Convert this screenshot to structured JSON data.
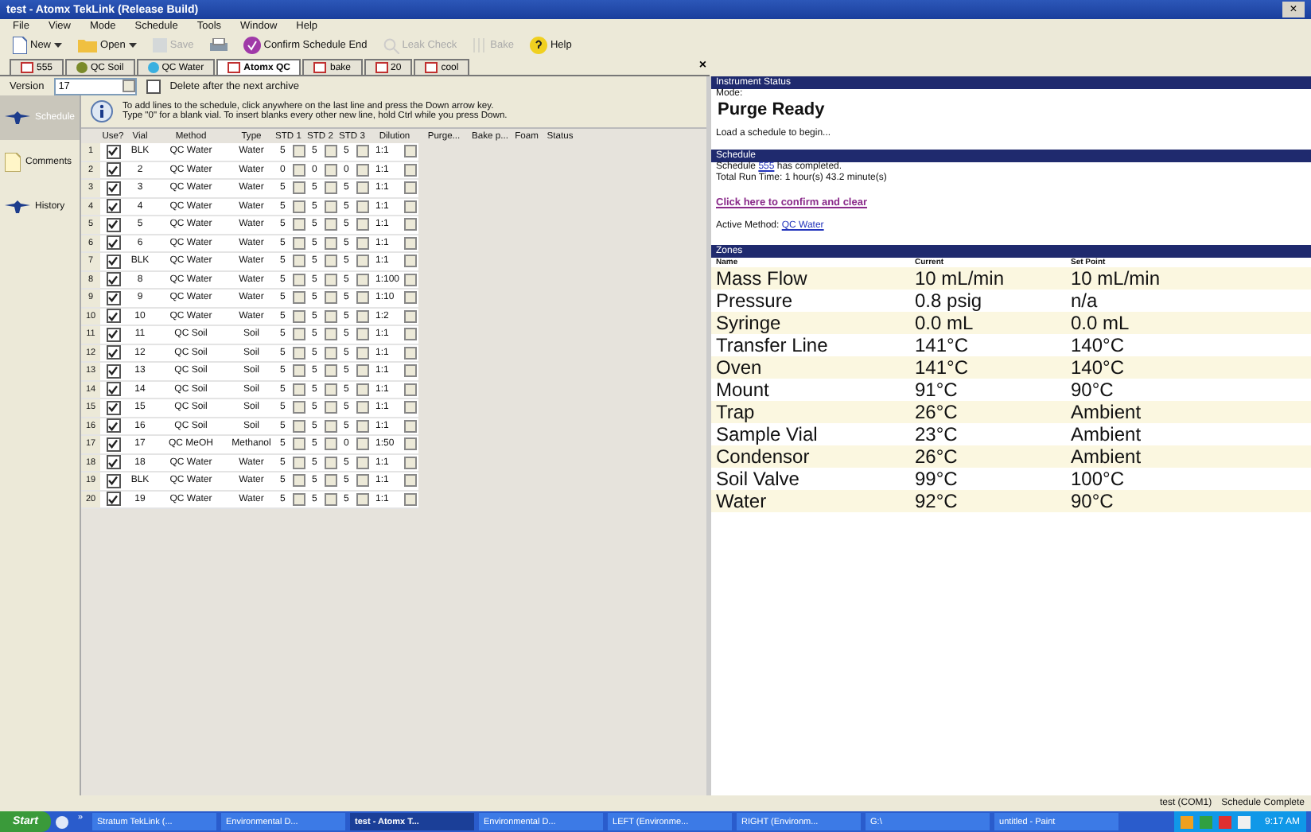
{
  "window": {
    "title": "test - Atomx TekLink (Release Build)",
    "close": "×"
  },
  "menu": [
    "File",
    "View",
    "Mode",
    "Schedule",
    "Tools",
    "Window",
    "Help"
  ],
  "toolbar": [
    {
      "kind": "new",
      "label": "New",
      "dropdown": true,
      "disabled": false
    },
    {
      "kind": "open",
      "label": "Open",
      "dropdown": true,
      "disabled": false
    },
    {
      "kind": "save",
      "label": "Save",
      "dropdown": false,
      "disabled": true
    },
    {
      "kind": "print",
      "dropdown": false,
      "disabled": false
    },
    {
      "kind": "confirm",
      "label": "Confirm Schedule End",
      "dropdown": false,
      "disabled": false
    },
    {
      "kind": "leak",
      "label": "Leak Check",
      "dropdown": false,
      "disabled": true
    },
    {
      "kind": "bake",
      "label": "Bake",
      "dropdown": false,
      "disabled": true
    },
    {
      "kind": "help",
      "label": "Help",
      "dropdown": false,
      "disabled": false
    }
  ],
  "tabs": [
    {
      "label": "555",
      "kind": "doc",
      "selected": false
    },
    {
      "label": "QC Soil",
      "kind": "soil",
      "selected": false
    },
    {
      "label": "QC Water",
      "kind": "water",
      "selected": false
    },
    {
      "label": "Atomx QC",
      "kind": "doc",
      "selected": true
    },
    {
      "label": "bake",
      "kind": "doc",
      "selected": false
    },
    {
      "label": "20",
      "kind": "doc",
      "selected": false
    },
    {
      "label": "cool",
      "kind": "doc",
      "selected": false
    }
  ],
  "tab_close": "×",
  "version": {
    "label": "Version",
    "value": "17",
    "delete_label": "Delete after the next archive",
    "delete_checked": false
  },
  "sidebar": [
    {
      "label": "Schedule",
      "kind": "bird",
      "selected": true
    },
    {
      "label": "Comments",
      "kind": "doc",
      "selected": false
    },
    {
      "label": "History",
      "kind": "bird",
      "selected": false
    }
  ],
  "info": [
    "To add lines to the schedule, click anywhere on the last line and press the Down arrow key.",
    "Type \"0\" for a blank vial. To insert blanks every other new line, hold Ctrl while you press Down."
  ],
  "table": {
    "columns": [
      "Use?",
      "Vial",
      "Method",
      "Type",
      "STD 1",
      "STD 2",
      "STD 3",
      "Dilution",
      "Purge...",
      "Bake p...",
      "Foam",
      "Status"
    ],
    "rows": [
      {
        "n": "1",
        "use": true,
        "vial": "BLK",
        "method": "QC Water",
        "type": "Water",
        "std": [
          "5",
          "5",
          "5"
        ],
        "dilution": "1:1"
      },
      {
        "n": "2",
        "use": true,
        "vial": "2",
        "method": "QC Water",
        "type": "Water",
        "std": [
          "0",
          "0",
          "0"
        ],
        "dilution": "1:1"
      },
      {
        "n": "3",
        "use": true,
        "vial": "3",
        "method": "QC Water",
        "type": "Water",
        "std": [
          "5",
          "5",
          "5"
        ],
        "dilution": "1:1"
      },
      {
        "n": "4",
        "use": true,
        "vial": "4",
        "method": "QC Water",
        "type": "Water",
        "std": [
          "5",
          "5",
          "5"
        ],
        "dilution": "1:1"
      },
      {
        "n": "5",
        "use": true,
        "vial": "5",
        "method": "QC Water",
        "type": "Water",
        "std": [
          "5",
          "5",
          "5"
        ],
        "dilution": "1:1"
      },
      {
        "n": "6",
        "use": true,
        "vial": "6",
        "method": "QC Water",
        "type": "Water",
        "std": [
          "5",
          "5",
          "5"
        ],
        "dilution": "1:1"
      },
      {
        "n": "7",
        "use": true,
        "vial": "BLK",
        "method": "QC Water",
        "type": "Water",
        "std": [
          "5",
          "5",
          "5"
        ],
        "dilution": "1:1"
      },
      {
        "n": "8",
        "use": true,
        "vial": "8",
        "method": "QC Water",
        "type": "Water",
        "std": [
          "5",
          "5",
          "5"
        ],
        "dilution": "1:100"
      },
      {
        "n": "9",
        "use": true,
        "vial": "9",
        "method": "QC Water",
        "type": "Water",
        "std": [
          "5",
          "5",
          "5"
        ],
        "dilution": "1:10"
      },
      {
        "n": "10",
        "use": true,
        "vial": "10",
        "method": "QC Water",
        "type": "Water",
        "std": [
          "5",
          "5",
          "5"
        ],
        "dilution": "1:2"
      },
      {
        "n": "11",
        "use": true,
        "vial": "11",
        "method": "QC Soil",
        "type": "Soil",
        "std": [
          "5",
          "5",
          "5"
        ],
        "dilution": "1:1"
      },
      {
        "n": "12",
        "use": true,
        "vial": "12",
        "method": "QC Soil",
        "type": "Soil",
        "std": [
          "5",
          "5",
          "5"
        ],
        "dilution": "1:1"
      },
      {
        "n": "13",
        "use": true,
        "vial": "13",
        "method": "QC Soil",
        "type": "Soil",
        "std": [
          "5",
          "5",
          "5"
        ],
        "dilution": "1:1"
      },
      {
        "n": "14",
        "use": true,
        "vial": "14",
        "method": "QC Soil",
        "type": "Soil",
        "std": [
          "5",
          "5",
          "5"
        ],
        "dilution": "1:1"
      },
      {
        "n": "15",
        "use": true,
        "vial": "15",
        "method": "QC Soil",
        "type": "Soil",
        "std": [
          "5",
          "5",
          "5"
        ],
        "dilution": "1:1"
      },
      {
        "n": "16",
        "use": true,
        "vial": "16",
        "method": "QC Soil",
        "type": "Soil",
        "std": [
          "5",
          "5",
          "5"
        ],
        "dilution": "1:1"
      },
      {
        "n": "17",
        "use": true,
        "vial": "17",
        "method": "QC MeOH",
        "type": "Methanol",
        "std": [
          "5",
          "5",
          "0"
        ],
        "dilution": "1:50"
      },
      {
        "n": "18",
        "use": true,
        "vial": "18",
        "method": "QC Water",
        "type": "Water",
        "std": [
          "5",
          "5",
          "5"
        ],
        "dilution": "1:1"
      },
      {
        "n": "19",
        "use": true,
        "vial": "BLK",
        "method": "QC Water",
        "type": "Water",
        "std": [
          "5",
          "5",
          "5"
        ],
        "dilution": "1:1"
      },
      {
        "n": "20",
        "use": true,
        "vial": "19",
        "method": "QC Water",
        "type": "Water",
        "std": [
          "5",
          "5",
          "5"
        ],
        "dilution": "1:1"
      }
    ]
  },
  "status_panel": {
    "title": "Instrument Status",
    "mode_label": "Mode:",
    "mode": "Purge Ready",
    "hint": "Load a schedule to begin...",
    "schedule_title": "Schedule",
    "schedule_pre": "Schedule ",
    "schedule_link": "555",
    "schedule_post": " has completed.",
    "run_time": "Total Run Time: 1 hour(s) 43.2 minute(s)",
    "confirm_link": "Click here to confirm and clear",
    "active_label": "Active Method: ",
    "active_link": "QC Water",
    "zones_title": "Zones",
    "zone_columns": [
      "Name",
      "Current",
      "Set Point"
    ],
    "zones": [
      [
        "Mass Flow",
        "10 mL/min",
        "10 mL/min"
      ],
      [
        "Pressure",
        "0.8 psig",
        "n/a"
      ],
      [
        "Syringe",
        "0.0 mL",
        "0.0 mL"
      ],
      [
        "Transfer Line",
        "141°C",
        "140°C"
      ],
      [
        "Oven",
        "141°C",
        "140°C"
      ],
      [
        "Mount",
        "91°C",
        "90°C"
      ],
      [
        "Trap",
        "26°C",
        "Ambient"
      ],
      [
        "Sample Vial",
        "23°C",
        "Ambient"
      ],
      [
        "Condensor",
        "26°C",
        "Ambient"
      ],
      [
        "Soil Valve",
        "99°C",
        "100°C"
      ],
      [
        "Water",
        "92°C",
        "90°C"
      ]
    ]
  },
  "status_bar": {
    "port": "test (COM1)",
    "state": "Schedule Complete"
  },
  "taskbar": {
    "start": "Start",
    "more": "»",
    "items": [
      {
        "label": "Stratum TekLink (...",
        "selected": false
      },
      {
        "label": "Environmental D...",
        "selected": false
      },
      {
        "label": "test - Atomx T...",
        "selected": true
      },
      {
        "label": "Environmental D...",
        "selected": false
      },
      {
        "label": "LEFT (Environme...",
        "selected": false
      },
      {
        "label": "RIGHT (Environm...",
        "selected": false
      },
      {
        "label": "G:\\",
        "selected": false
      },
      {
        "label": "untitled - Paint",
        "selected": false
      }
    ],
    "clock": "9:17 AM"
  }
}
